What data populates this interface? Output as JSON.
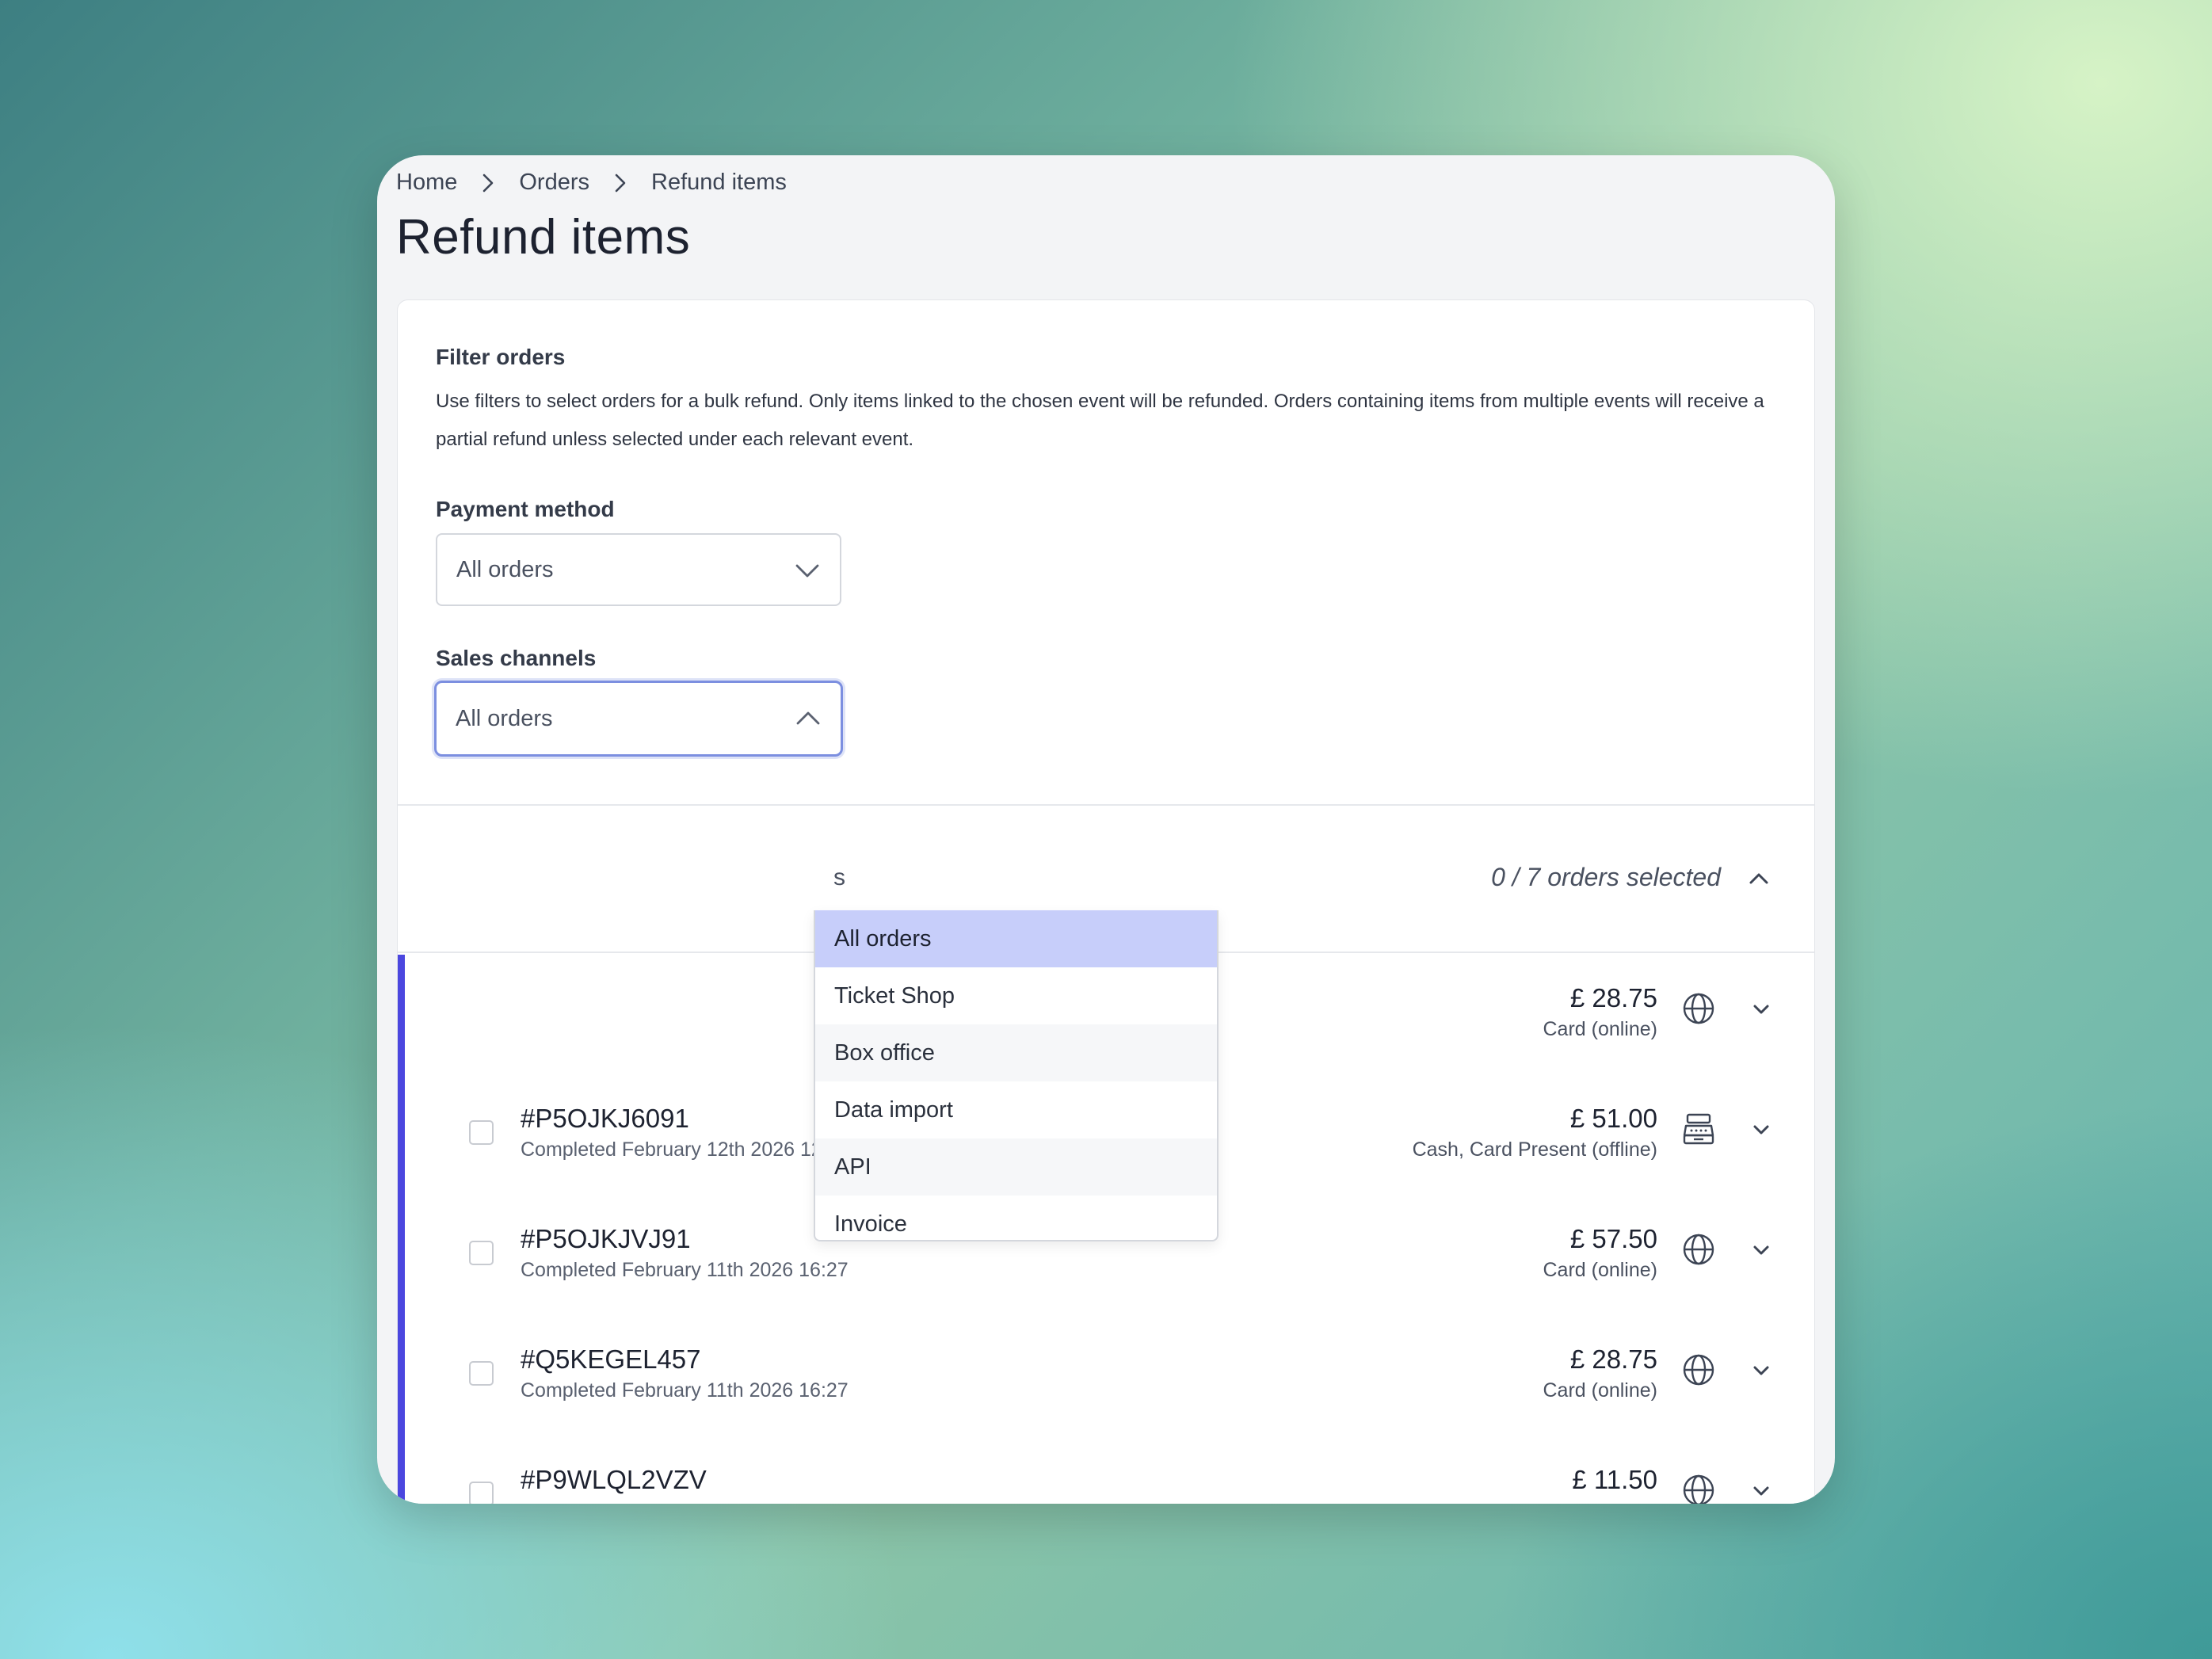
{
  "breadcrumb": {
    "items": [
      "Home",
      "Orders",
      "Refund items"
    ]
  },
  "page": {
    "title": "Refund items"
  },
  "filter": {
    "title": "Filter orders",
    "description": "Use filters to select orders for a bulk refund. Only items linked to the chosen event will be refunded. Orders containing items from multiple events will receive a partial refund unless selected under each relevant event.",
    "payment_method": {
      "label": "Payment method",
      "value": "All orders"
    },
    "sales_channels": {
      "label": "Sales channels",
      "value": "All orders",
      "options": [
        "All orders",
        "Ticket Shop",
        "Box office",
        "Data import",
        "API",
        "Invoice"
      ],
      "highlighted": "All orders"
    }
  },
  "summary": {
    "count_text": "0 / 7 orders selected",
    "partial_text": "s"
  },
  "orders": [
    {
      "id": "",
      "status": "",
      "amount": "£ 28.75",
      "method": "Card (online)",
      "channel_icon": "globe-icon"
    },
    {
      "id": "#P5OJKJ6091",
      "status": "Completed February 12th 2026 12:27",
      "amount": "£ 51.00",
      "method": "Cash, Card Present (offline)",
      "channel_icon": "cash-register-icon"
    },
    {
      "id": "#P5OJKJVJ91",
      "status": "Completed February 11th 2026 16:27",
      "amount": "£ 57.50",
      "method": "Card (online)",
      "channel_icon": "globe-icon"
    },
    {
      "id": "#Q5KEGEL457",
      "status": "Completed February 11th 2026 16:27",
      "amount": "£ 28.75",
      "method": "Card (online)",
      "channel_icon": "globe-icon"
    },
    {
      "id": "#P9WLQL2VZV",
      "status": "",
      "amount": "£ 11.50",
      "method": "",
      "channel_icon": "globe-icon"
    }
  ],
  "colors": {
    "accent": "#4b47df",
    "highlight": "#c7cefa",
    "focus_border": "#7c8fe0"
  }
}
